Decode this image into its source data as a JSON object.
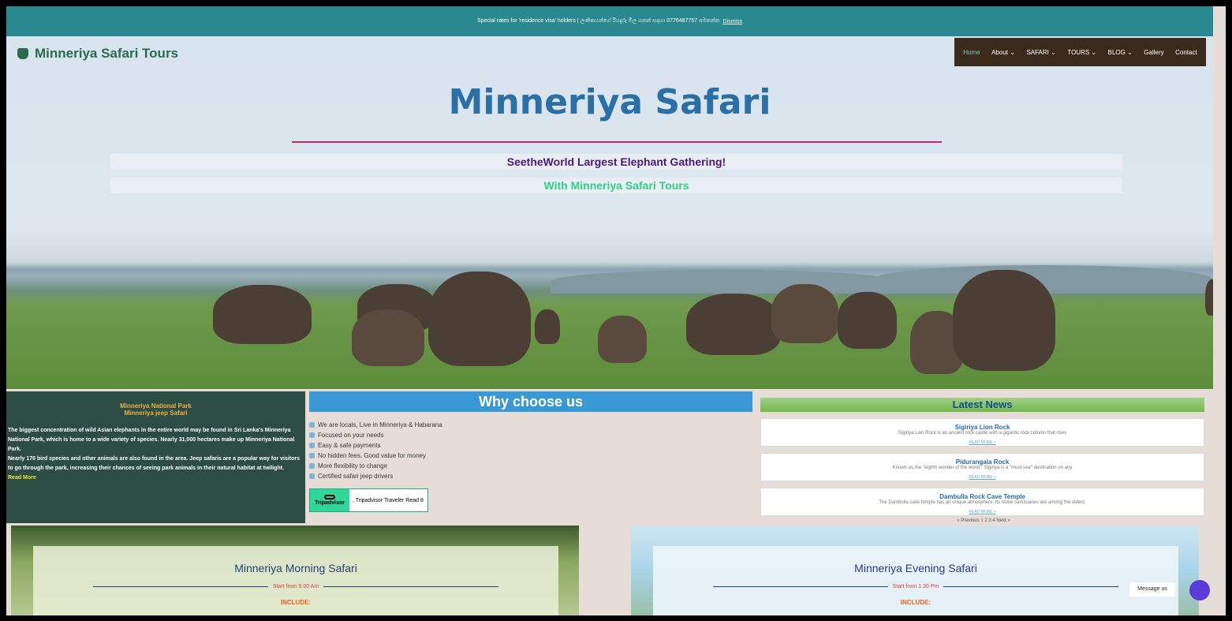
{
  "notice": {
    "text": "Special rates for 'residence visa' holders | ලංකිකයන්ගේ රියදුරු මිල ගනන් සදහා 0776487757 අමතන්න",
    "dismiss": "Dismiss"
  },
  "header": {
    "logo": "Minneriya Safari Tours",
    "nav": [
      {
        "label": "Home"
      },
      {
        "label": "About ⌄"
      },
      {
        "label": "SAFARI ⌄"
      },
      {
        "label": "TOURS ⌄"
      },
      {
        "label": "BLOG ⌄"
      },
      {
        "label": "Gallery"
      },
      {
        "label": "Contact"
      }
    ]
  },
  "hero": {
    "title": "Minneriya Safari",
    "tagline1": "SeetheWorld Largest Elephant Gathering!",
    "tagline2": "With Minneriya Safari Tours"
  },
  "park": {
    "heading1": "Minneriya National Park",
    "heading2": "Minneriya jeep Safari",
    "p1": "The biggest concentration of wild Asian elephants in the entire world may be found in Sri Lanka's Minneriya National Park, which is home to a wide variety of species. Nearly 31,000 hectares make up Minneriya National Park.",
    "p2": "Nearly 170 bird species and other animals are also found in the area. Jeep safaris are a popular way for visitors to go through the park, increasing their chances of seeing park animals in their natural habitat at twilight.",
    "read_more": "Read More"
  },
  "why": {
    "title": "Why choose us",
    "items": [
      "We are locals, Live in Minneriya & Habarana",
      "Focused on your needs",
      "Easy & safe payments",
      "No hidden fees. Good value for money",
      "More flexibility to change",
      "Certified safari jeep drivers"
    ],
    "tripadvisor_logo": "Tripadvisor",
    "tripadvisor_text": ", Tripadvisor Traveler   Read 8"
  },
  "news": {
    "title": "Latest News",
    "items": [
      {
        "title": "Sigiriya Lion Rock",
        "desc": "Sigiriya Lion Rock is an ancient rock castle with a gigantic rock column that rises",
        "more": "READ MORE »"
      },
      {
        "title": "Pidurangala Rock",
        "desc": "Known as the \"eighth wonder of the world,\" Sigiriya is a \"must-see\" destination on any",
        "more": "READ MORE »"
      },
      {
        "title": "Dambulla Rock Cave Temple",
        "desc": "The Dambulla cave temple has an unique atmosphere. Its stone sanctuaries are among the oldest,",
        "more": "READ MORE »"
      }
    ],
    "pager": {
      "prev": "« Previous",
      "pages": [
        "1",
        "2",
        "3",
        "4"
      ],
      "next": "Next »"
    }
  },
  "cards": {
    "morning": {
      "title": "Minneriya Morning Safari",
      "start": "Start from 6.00 Am",
      "include": "INCLUDE:"
    },
    "evening": {
      "title": "Minneriya Evening Safari",
      "start": "Start from 1.30 Pm",
      "include": "INCLUDE:"
    }
  },
  "chat": {
    "label": "Message us"
  },
  "colors": {
    "accent": "#2a8890",
    "nav_bg": "#3b2a1c",
    "title": "#2a6fa6"
  }
}
